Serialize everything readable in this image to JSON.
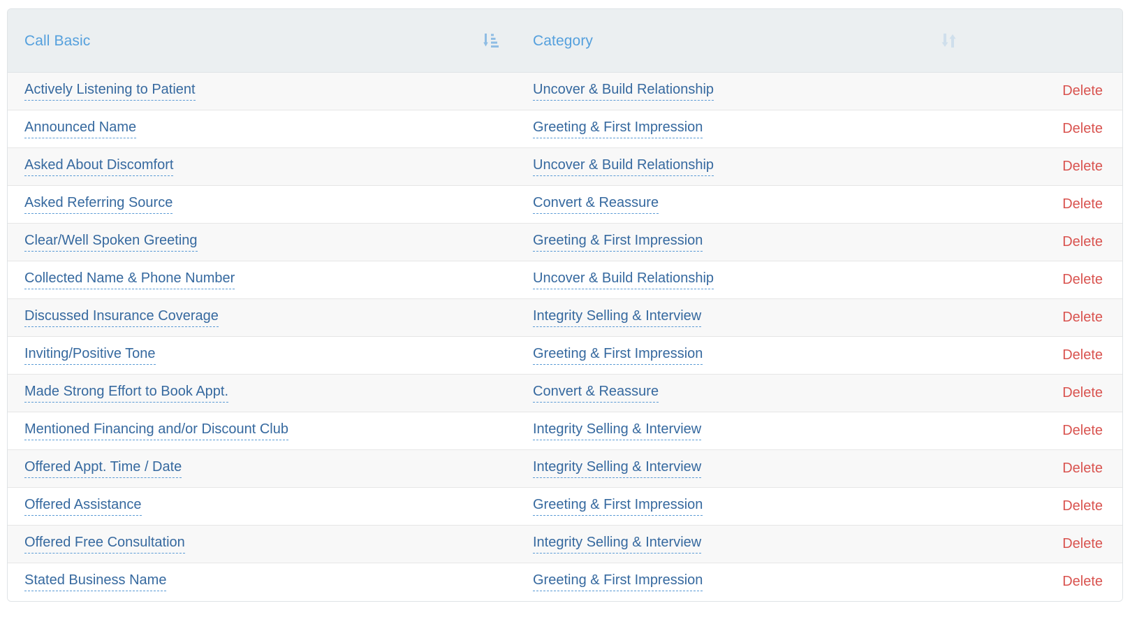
{
  "table": {
    "columns": [
      {
        "label": "Call Basic",
        "sort_icon": "sort-amount-down-icon",
        "sort_state": "ascending"
      },
      {
        "label": "Category",
        "sort_icon": "sort-unsorted-icon",
        "sort_state": "none"
      },
      {
        "label": "",
        "sort_icon": "",
        "sort_state": "none"
      }
    ],
    "action_label": "Delete",
    "rows": [
      {
        "basic": "Actively Listening to Patient",
        "category": "Uncover & Build Relationship",
        "action": "Delete"
      },
      {
        "basic": "Announced Name",
        "category": "Greeting & First Impression",
        "action": "Delete"
      },
      {
        "basic": "Asked About Discomfort",
        "category": "Uncover & Build Relationship",
        "action": "Delete"
      },
      {
        "basic": "Asked Referring Source",
        "category": "Convert & Reassure",
        "action": "Delete"
      },
      {
        "basic": "Clear/Well Spoken Greeting",
        "category": "Greeting & First Impression",
        "action": "Delete"
      },
      {
        "basic": "Collected Name & Phone Number",
        "category": "Uncover & Build Relationship",
        "action": "Delete"
      },
      {
        "basic": "Discussed Insurance Coverage",
        "category": "Integrity Selling & Interview",
        "action": "Delete"
      },
      {
        "basic": "Inviting/Positive Tone",
        "category": "Greeting & First Impression",
        "action": "Delete"
      },
      {
        "basic": "Made Strong Effort to Book Appt.",
        "category": "Convert & Reassure",
        "action": "Delete"
      },
      {
        "basic": "Mentioned Financing and/or Discount Club",
        "category": "Integrity Selling & Interview",
        "action": "Delete"
      },
      {
        "basic": "Offered Appt. Time / Date",
        "category": "Integrity Selling & Interview",
        "action": "Delete"
      },
      {
        "basic": "Offered Assistance",
        "category": "Greeting & First Impression",
        "action": "Delete"
      },
      {
        "basic": "Offered Free Consultation",
        "category": "Integrity Selling & Interview",
        "action": "Delete"
      },
      {
        "basic": "Stated Business Name",
        "category": "Greeting & First Impression",
        "action": "Delete"
      }
    ]
  },
  "colors": {
    "header_bg": "#ebeff1",
    "header_text": "#55a0dd",
    "link": "#36699f",
    "link_underline": "#5b9bd5",
    "delete": "#d9534f",
    "row_stripe": "#f8f8f8",
    "row_border": "#e6e6e6",
    "card_border": "#dfe3e6",
    "sort_active": "#8fbde4",
    "sort_inactive": "#cfdfec"
  }
}
